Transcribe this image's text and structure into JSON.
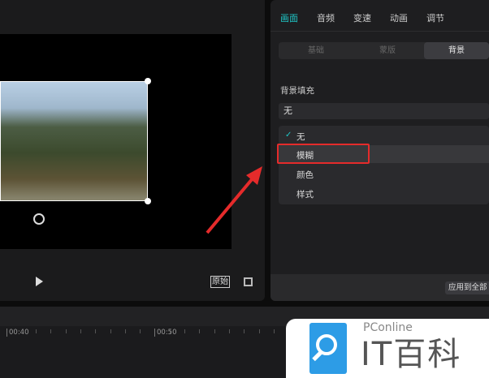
{
  "player": {
    "original_label": "原始"
  },
  "tabs": [
    "画面",
    "音频",
    "变速",
    "动画",
    "调节"
  ],
  "subtabs": [
    "基础",
    "蒙版",
    "背景"
  ],
  "background_fill": {
    "label": "背景填充",
    "value": "无",
    "options": [
      "无",
      "模糊",
      "颜色",
      "样式"
    ],
    "selected": "无",
    "highlighted": "模糊"
  },
  "apply_all": "应用到全部",
  "timeline": {
    "marks": [
      "00:40",
      "00:50"
    ]
  },
  "watermark": {
    "brand": "PConline",
    "name": "IT百科"
  },
  "colors": {
    "accent": "#1fc7c7",
    "highlight": "#e52b2b",
    "arrow": "#e52b2b"
  }
}
